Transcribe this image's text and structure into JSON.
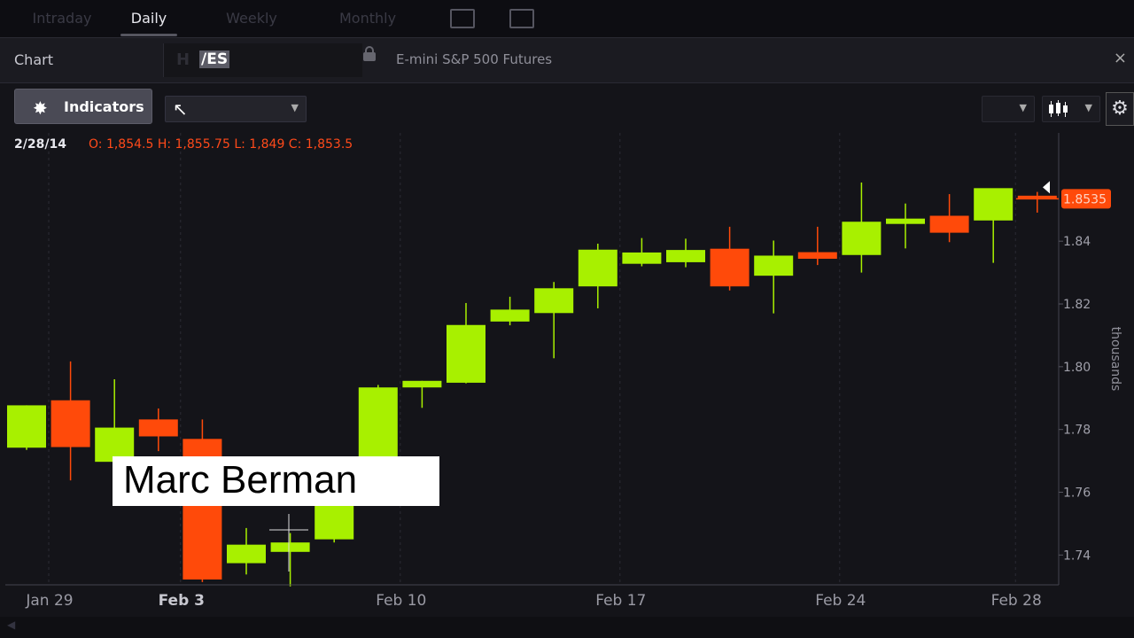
{
  "tabs": [
    {
      "label": "Intraday",
      "active": false
    },
    {
      "label": "Daily",
      "active": true
    },
    {
      "label": "Weekly",
      "active": false
    },
    {
      "label": "Monthly",
      "active": false
    }
  ],
  "chart_header": {
    "label": "Chart",
    "symbol": "/ES",
    "description": "E-mini S&P 500 Futures",
    "close_icon": "×"
  },
  "toolbar": {
    "indicators_label": "Indicators",
    "gear_icon": "✸",
    "cursor_icon": "↖",
    "settings_icon": "⚙"
  },
  "ohlc": {
    "date": "2/28/14",
    "values": "O: 1,854.5  H: 1,855.75  L: 1,849  C: 1,853.5"
  },
  "caption": "Marc Berman",
  "chart_data": {
    "type": "candlestick",
    "x_ticks": [
      {
        "label": "Jan 29",
        "index": 0,
        "bold": false
      },
      {
        "label": "Feb 3",
        "index": 3,
        "bold": true
      },
      {
        "label": "Feb 10",
        "index": 8,
        "bold": false
      },
      {
        "label": "Feb 17",
        "index": 13,
        "bold": false
      },
      {
        "label": "Feb 24",
        "index": 18,
        "bold": false
      },
      {
        "label": "Feb 28",
        "index": 22,
        "bold": false
      }
    ],
    "y_ticks": [
      "1.74",
      "1.76",
      "1.78",
      "1.80",
      "1.82",
      "1.84"
    ],
    "y_tick_values": [
      1.74,
      1.76,
      1.78,
      1.8,
      1.82,
      1.84
    ],
    "ylabel": "thousands",
    "ylim": [
      1.7305,
      1.8745
    ],
    "last_price_label": "1.8535",
    "last_price": 1.8535,
    "colors": {
      "up": "#a8f000",
      "down": "#ff4a0a",
      "grid": "#2c2c35",
      "axis": "#a0a0aa"
    },
    "candles": [
      {
        "o": 1.7742,
        "h": 1.7877,
        "l": 1.7735,
        "c": 1.7877
      },
      {
        "o": 1.7893,
        "h": 1.8017,
        "l": 1.7638,
        "c": 1.7744
      },
      {
        "o": 1.7697,
        "h": 1.796,
        "l": 1.769,
        "c": 1.7806
      },
      {
        "o": 1.7832,
        "h": 1.7867,
        "l": 1.7731,
        "c": 1.7778
      },
      {
        "o": 1.777,
        "h": 1.7832,
        "l": 1.7314,
        "c": 1.7322
      },
      {
        "o": 1.7374,
        "h": 1.7486,
        "l": 1.7338,
        "c": 1.7433
      },
      {
        "o": 1.741,
        "h": 1.747,
        "l": 1.73,
        "c": 1.744
      },
      {
        "o": 1.745,
        "h": 1.769,
        "l": 1.744,
        "c": 1.767
      },
      {
        "o": 1.7684,
        "h": 1.7942,
        "l": 1.763,
        "c": 1.7934
      },
      {
        "o": 1.7934,
        "h": 1.7955,
        "l": 1.7869,
        "c": 1.7955
      },
      {
        "o": 1.7949,
        "h": 1.8203,
        "l": 1.7947,
        "c": 1.8133
      },
      {
        "o": 1.8144,
        "h": 1.8223,
        "l": 1.8132,
        "c": 1.8182
      },
      {
        "o": 1.8171,
        "h": 1.827,
        "l": 1.8027,
        "c": 1.825
      },
      {
        "o": 1.8256,
        "h": 1.8392,
        "l": 1.8186,
        "c": 1.8373
      },
      {
        "o": 1.8328,
        "h": 1.841,
        "l": 1.832,
        "c": 1.8364
      },
      {
        "o": 1.8333,
        "h": 1.8408,
        "l": 1.8317,
        "c": 1.8372
      },
      {
        "o": 1.8376,
        "h": 1.8446,
        "l": 1.8243,
        "c": 1.8256
      },
      {
        "o": 1.829,
        "h": 1.8402,
        "l": 1.817,
        "c": 1.8354
      },
      {
        "o": 1.8365,
        "h": 1.8446,
        "l": 1.8324,
        "c": 1.8344
      },
      {
        "o": 1.8356,
        "h": 1.8587,
        "l": 1.83,
        "c": 1.8462
      },
      {
        "o": 1.8455,
        "h": 1.852,
        "l": 1.8377,
        "c": 1.8472
      },
      {
        "o": 1.8481,
        "h": 1.855,
        "l": 1.8397,
        "c": 1.8427
      },
      {
        "o": 1.8466,
        "h": 1.8545,
        "l": 1.8331,
        "c": 1.8569
      },
      {
        "o": 1.8545,
        "h": 1.8557,
        "l": 1.8491,
        "c": 1.8537
      }
    ]
  }
}
